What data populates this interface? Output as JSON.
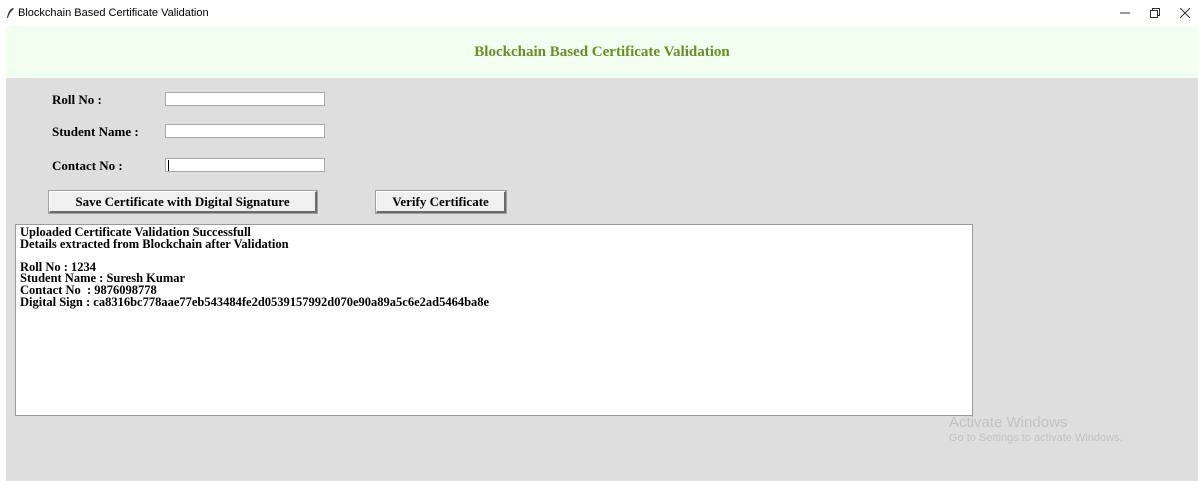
{
  "window": {
    "title": "Blockchain Based Certificate Validation",
    "controls": {
      "minimize": "—",
      "maximize": "❐",
      "close": "✕"
    }
  },
  "header": {
    "title": "Blockchain Based Certificate Validation",
    "title_color": "#6b8e23",
    "background": "#f0fff0"
  },
  "form": {
    "roll_no": {
      "label": "Roll No :",
      "value": ""
    },
    "student_name": {
      "label": "Student Name :",
      "value": ""
    },
    "contact_no": {
      "label": "Contact No :",
      "value": ""
    }
  },
  "buttons": {
    "save": "Save Certificate with Digital Signature",
    "verify": "Verify Certificate"
  },
  "output": {
    "lines": [
      "Uploaded Certificate Validation Successfull",
      "Details extracted from Blockchain after Validation",
      "",
      "Roll No : 1234",
      "Student Name : Suresh Kumar",
      "Contact No  : 9876098778",
      "Digital Sign : ca8316bc778aae77eb543484fe2d0539157992d070e90a89a5c6e2ad5464ba8e"
    ]
  },
  "watermark": {
    "title": "Activate Windows",
    "subtitle": "Go to Settings to activate Windows."
  },
  "icons": {
    "app": "feather-icon",
    "minimize": "minimize-icon",
    "maximize": "restore-icon",
    "close": "close-icon"
  }
}
